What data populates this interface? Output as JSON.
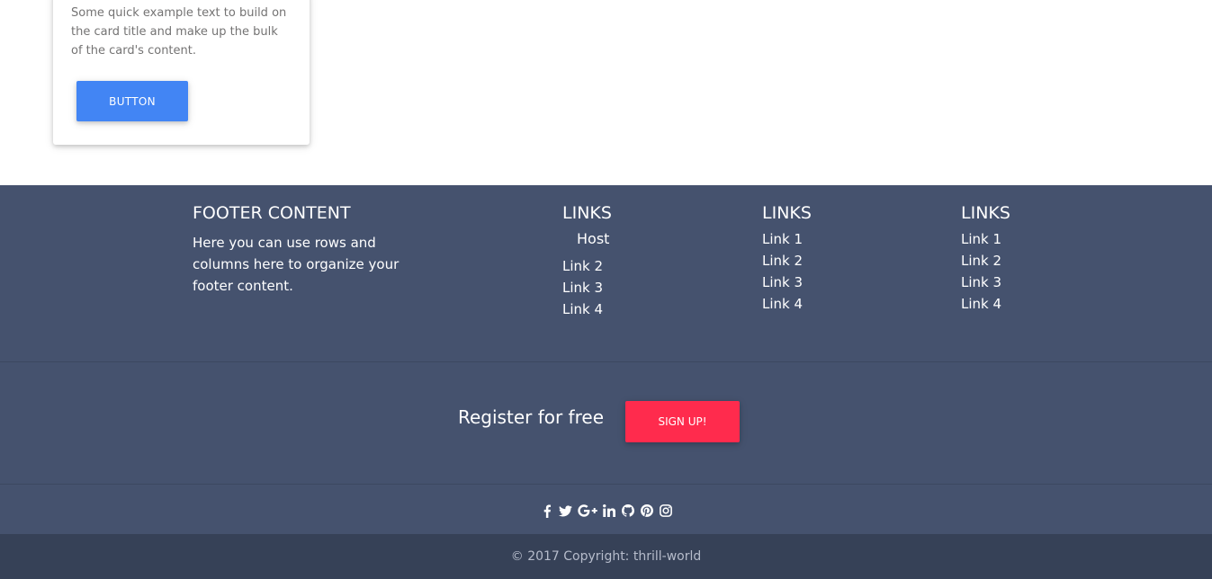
{
  "card": {
    "text": "Some quick example text to build on the card title and make up the bulk of the card's content.",
    "button_label": "BUTTON"
  },
  "footer": {
    "content_title": "FOOTER CONTENT",
    "content_text": "Here you can use rows and columns here to organize your footer content.",
    "columns": [
      {
        "title": "LINKS",
        "host_label": "Host",
        "links": [
          "Link 2",
          "Link 3",
          "Link 4"
        ]
      },
      {
        "title": "LINKS",
        "links": [
          "Link 1",
          "Link 2",
          "Link 3",
          "Link 4"
        ]
      },
      {
        "title": "LINKS",
        "links": [
          "Link 1",
          "Link 2",
          "Link 3",
          "Link 4"
        ]
      }
    ],
    "register_text": "Register for free",
    "signup_label": "SIGN UP!",
    "social_icons": [
      "facebook-icon",
      "twitter-icon",
      "google-plus-icon",
      "linkedin-icon",
      "github-icon",
      "pinterest-icon",
      "instagram-icon"
    ],
    "copyright": "© 2017 Copyright: thrill-world"
  },
  "colors": {
    "footer_bg": "#45526e",
    "copyright_bg": "#364157",
    "primary_button": "#4285f4",
    "signup_button": "#ff2b4d"
  }
}
